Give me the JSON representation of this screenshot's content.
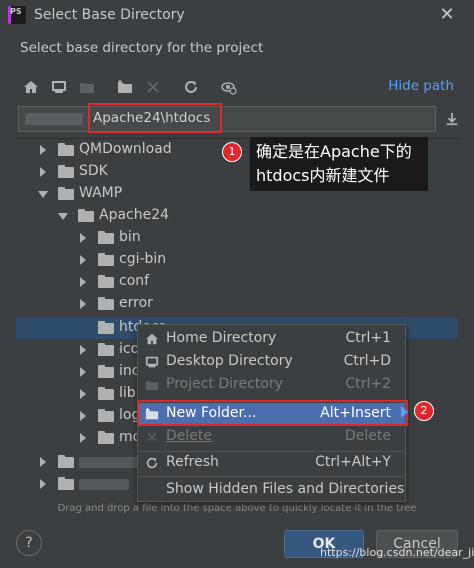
{
  "window": {
    "title": "Select Base Directory",
    "app_icon_label": "PS"
  },
  "dialog": {
    "subtitle": "Select base directory for the project"
  },
  "toolbar": {
    "hide_path_label": "Hide path"
  },
  "path": {
    "value": "Apache24\\htdocs"
  },
  "tree": {
    "items": [
      {
        "label": "QMDownload",
        "depth": 1,
        "expanded": false
      },
      {
        "label": "SDK",
        "depth": 1,
        "expanded": false
      },
      {
        "label": "WAMP",
        "depth": 1,
        "expanded": true
      },
      {
        "label": "Apache24",
        "depth": 2,
        "expanded": true
      },
      {
        "label": "bin",
        "depth": 3,
        "expanded": false
      },
      {
        "label": "cgi-bin",
        "depth": 3,
        "expanded": false
      },
      {
        "label": "conf",
        "depth": 3,
        "expanded": false
      },
      {
        "label": "error",
        "depth": 3,
        "expanded": false
      },
      {
        "label": "htdocs",
        "depth": 3,
        "expanded": false,
        "selected": true
      },
      {
        "label": "icons",
        "depth": 3,
        "expanded": false
      },
      {
        "label": "include",
        "depth": 3,
        "expanded": false
      },
      {
        "label": "lib",
        "depth": 3,
        "expanded": false
      },
      {
        "label": "logs",
        "depth": 3,
        "expanded": false
      },
      {
        "label": "modules",
        "depth": 3,
        "expanded": false
      }
    ]
  },
  "context_menu": {
    "items": [
      {
        "label": "Home Directory",
        "shortcut": "Ctrl+1",
        "disabled": false,
        "icon": "home-icon"
      },
      {
        "label": "Desktop Directory",
        "shortcut": "Ctrl+D",
        "disabled": false,
        "icon": "desktop-icon"
      },
      {
        "label": "Project Directory",
        "shortcut": "Ctrl+2",
        "disabled": true,
        "icon": "project-icon"
      },
      {
        "label": "New Folder...",
        "shortcut": "Alt+Insert",
        "disabled": false,
        "highlighted": true,
        "icon": "new-folder-icon"
      },
      {
        "label": "Delete",
        "shortcut": "Delete",
        "disabled": true,
        "icon": "delete-icon"
      },
      {
        "label": "Refresh",
        "shortcut": "Ctrl+Alt+Y",
        "disabled": false,
        "icon": "refresh-icon"
      },
      {
        "label": "Show Hidden Files and Directories",
        "shortcut": "",
        "disabled": false,
        "icon": ""
      }
    ]
  },
  "hint": "Drag and drop a file into the space above to quickly locate it in the tree",
  "buttons": {
    "help": "?",
    "ok": "OK",
    "cancel": "Cancel"
  },
  "annotations": {
    "badge_1": "1",
    "badge_2": "2",
    "note_line1": "确定是在Apache下的",
    "note_line2": "htdocs内新建文件"
  },
  "watermark": "https://blog.csdn.net/dear_jing",
  "colors": {
    "accent": "#589df6",
    "highlight": "#4b6eaf",
    "annotation_red": "#e0272b",
    "selection": "#2f4d6a"
  }
}
